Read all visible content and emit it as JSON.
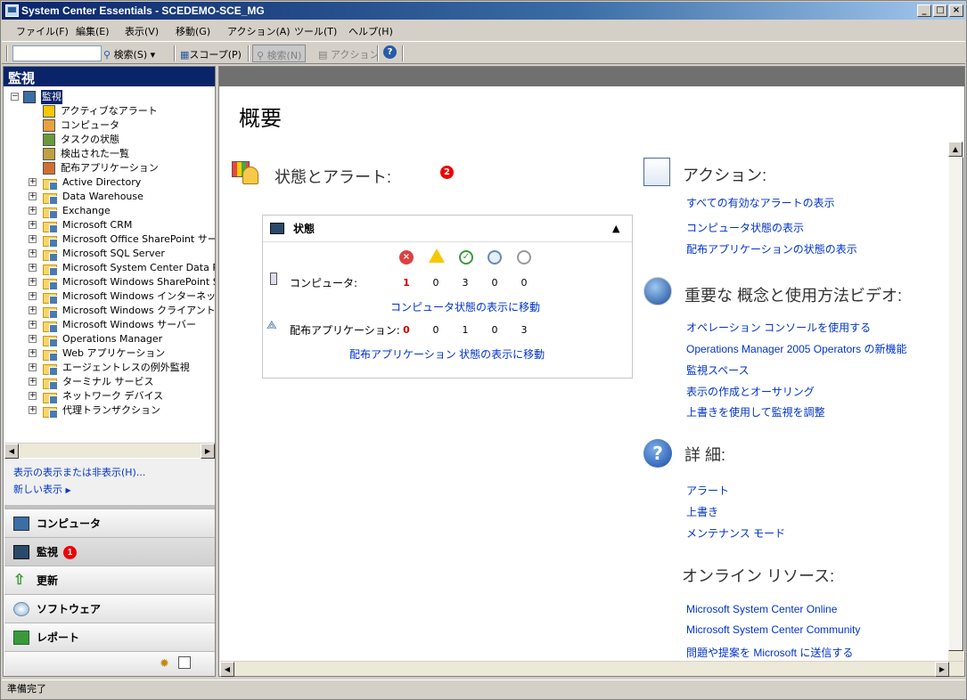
{
  "window": {
    "title": "System Center Essentials - SCEDEMO-SCE_MG",
    "min_icon": "minimize-icon",
    "max_icon": "maximize-icon",
    "close_icon": "close-icon"
  },
  "menu": [
    "ファイル(F)",
    "編集(E)",
    "表示(V)",
    "移動(G)",
    "アクション(A)",
    "ツール(T)",
    "ヘルプ(H)"
  ],
  "toolbar": {
    "search_value": "",
    "search_label": "検索(S)",
    "scope_label": "スコープ(P)",
    "find_label": "検索(N)",
    "action_label": "アクション",
    "help_icon": "help-icon"
  },
  "left": {
    "header": "監視",
    "root": "監視",
    "root_children": [
      "アクティブなアラート",
      "コンピュータ",
      "タスクの状態",
      "検出された一覧",
      "配布アプリケーション"
    ],
    "folders": [
      "Active Directory",
      "Data Warehouse",
      "Exchange",
      "Microsoft CRM",
      "Microsoft Office SharePoint サーバ",
      "Microsoft SQL Server",
      "Microsoft System Center Data Pro",
      "Microsoft Windows SharePoint Ser",
      "Microsoft Windows インターネット イ",
      "Microsoft Windows クライアント",
      "Microsoft Windows サーバー",
      "Operations Manager",
      "Web アプリケーション",
      "エージェントレスの例外監視",
      "ターミナル サービス",
      "ネットワーク デバイス",
      "代理トランザクション"
    ],
    "show_hide": "表示の表示または非表示(H)...",
    "new_view": "新しい表示",
    "nav": [
      "コンピュータ",
      "監視",
      "更新",
      "ソフトウェア",
      "レポート"
    ],
    "nav_badge": "1"
  },
  "overview": {
    "title": "概要",
    "state_alert_heading": "状態とアラート:",
    "state_badge": "2",
    "state_box_title": "状態",
    "computer_label": "コンピュータ:",
    "computer_counts": [
      "1",
      "0",
      "3",
      "0",
      "0"
    ],
    "computer_link": "コンピュータ状態の表示に移動",
    "app_label": "配布アプリケーション:",
    "app_counts": [
      "0",
      "0",
      "1",
      "0",
      "3"
    ],
    "app_link": "配布アプリケーション 状態の表示に移動",
    "icons": [
      "error-icon",
      "warning-icon",
      "success-icon",
      "maintenance-icon",
      "unmonitored-icon"
    ]
  },
  "actions": {
    "heading": "アクション:",
    "links": [
      "すべての有効なアラートの表示",
      "コンピュータ状態の表示",
      "配布アプリケーションの状態の表示"
    ]
  },
  "videos": {
    "heading": "重要な 概念と使用方法ビデオ:",
    "links": [
      "オペレーション コンソールを使用する",
      "Operations Manager 2005 Operators の新機能",
      "監視スペース",
      "表示の作成とオーサリング",
      "上書きを使用して監視を調整"
    ]
  },
  "details": {
    "heading": "詳 細:",
    "links": [
      "アラート",
      "上書き",
      "メンテナンス モード"
    ]
  },
  "online": {
    "heading": "オンライン リソース:",
    "links": [
      "Microsoft System Center Online",
      "Microsoft System Center Community",
      "問題や提案を Microsoft に送信する"
    ]
  },
  "status": {
    "text": "準備完了"
  },
  "colors": {
    "title_bar": "#0a246a",
    "link": "#0033cc",
    "badge": "#ee0000",
    "error": "#e04040"
  }
}
